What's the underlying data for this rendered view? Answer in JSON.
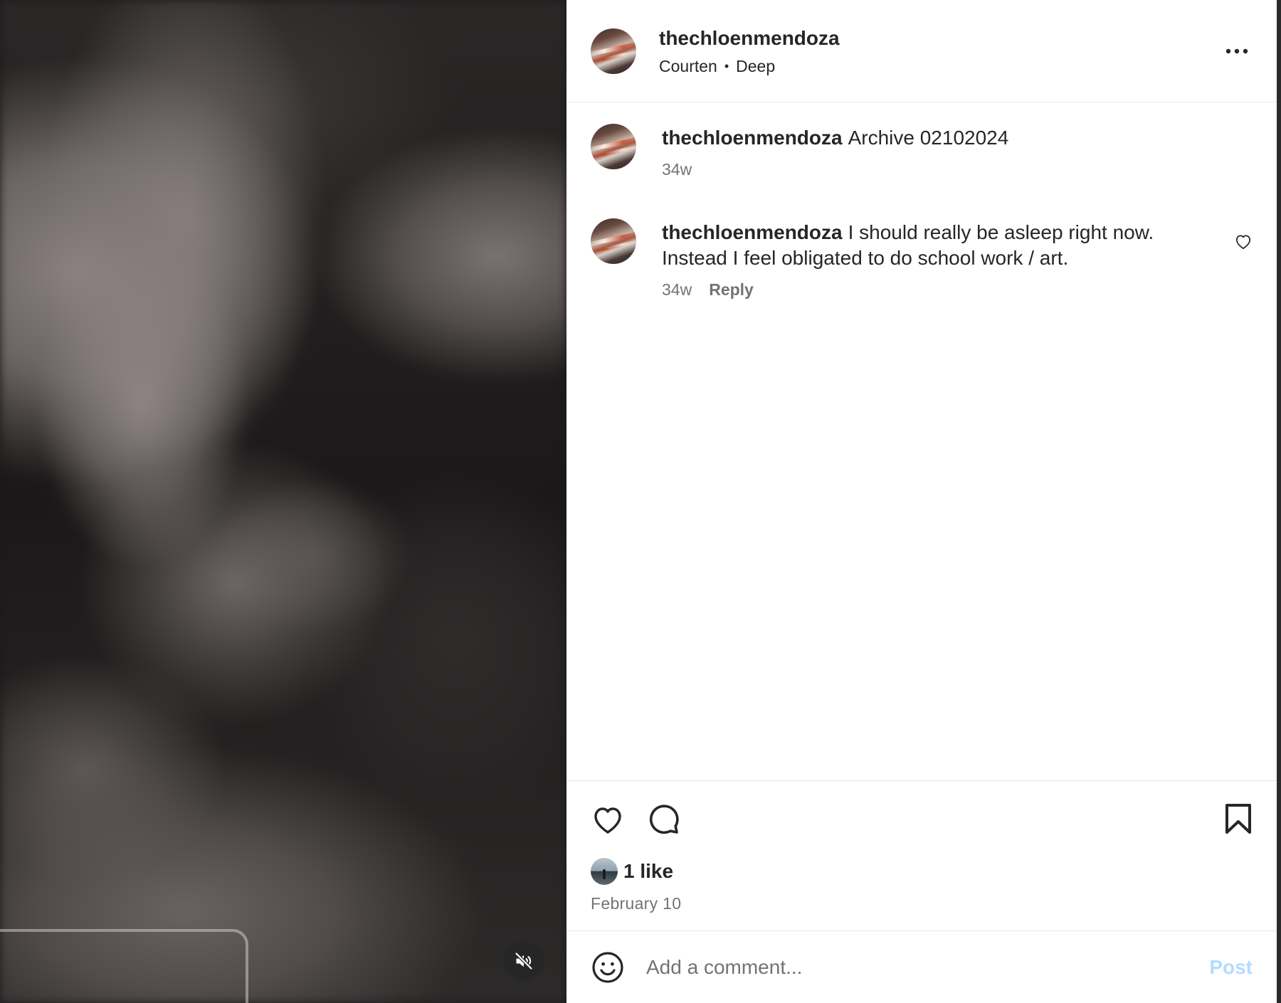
{
  "header": {
    "username": "thechloenmendoza",
    "audio_artist": "Courten",
    "separator": "•",
    "audio_title": "Deep",
    "more_icon": "more-horizontal-icon"
  },
  "comments": [
    {
      "username": "thechloenmendoza",
      "text": "Archive 02102024",
      "time": "34w"
    },
    {
      "username": "thechloenmendoza",
      "text": "I should really be asleep right now. Instead I feel obligated to do school work / art.",
      "time": "34w",
      "reply_label": "Reply"
    }
  ],
  "actions": {
    "like_icon": "heart-icon",
    "comment_icon": "comment-bubble-icon",
    "save_icon": "bookmark-icon"
  },
  "likes": {
    "count_label": "1 like"
  },
  "post_date": "February 10",
  "add_comment": {
    "placeholder": "Add a comment...",
    "post_label": "Post"
  },
  "media": {
    "mute_icon": "speaker-muted-icon"
  },
  "colors": {
    "text_primary": "#262626",
    "text_secondary": "#737373",
    "post_button_disabled": "#b3dbff",
    "divider": "#e6e6e6"
  }
}
